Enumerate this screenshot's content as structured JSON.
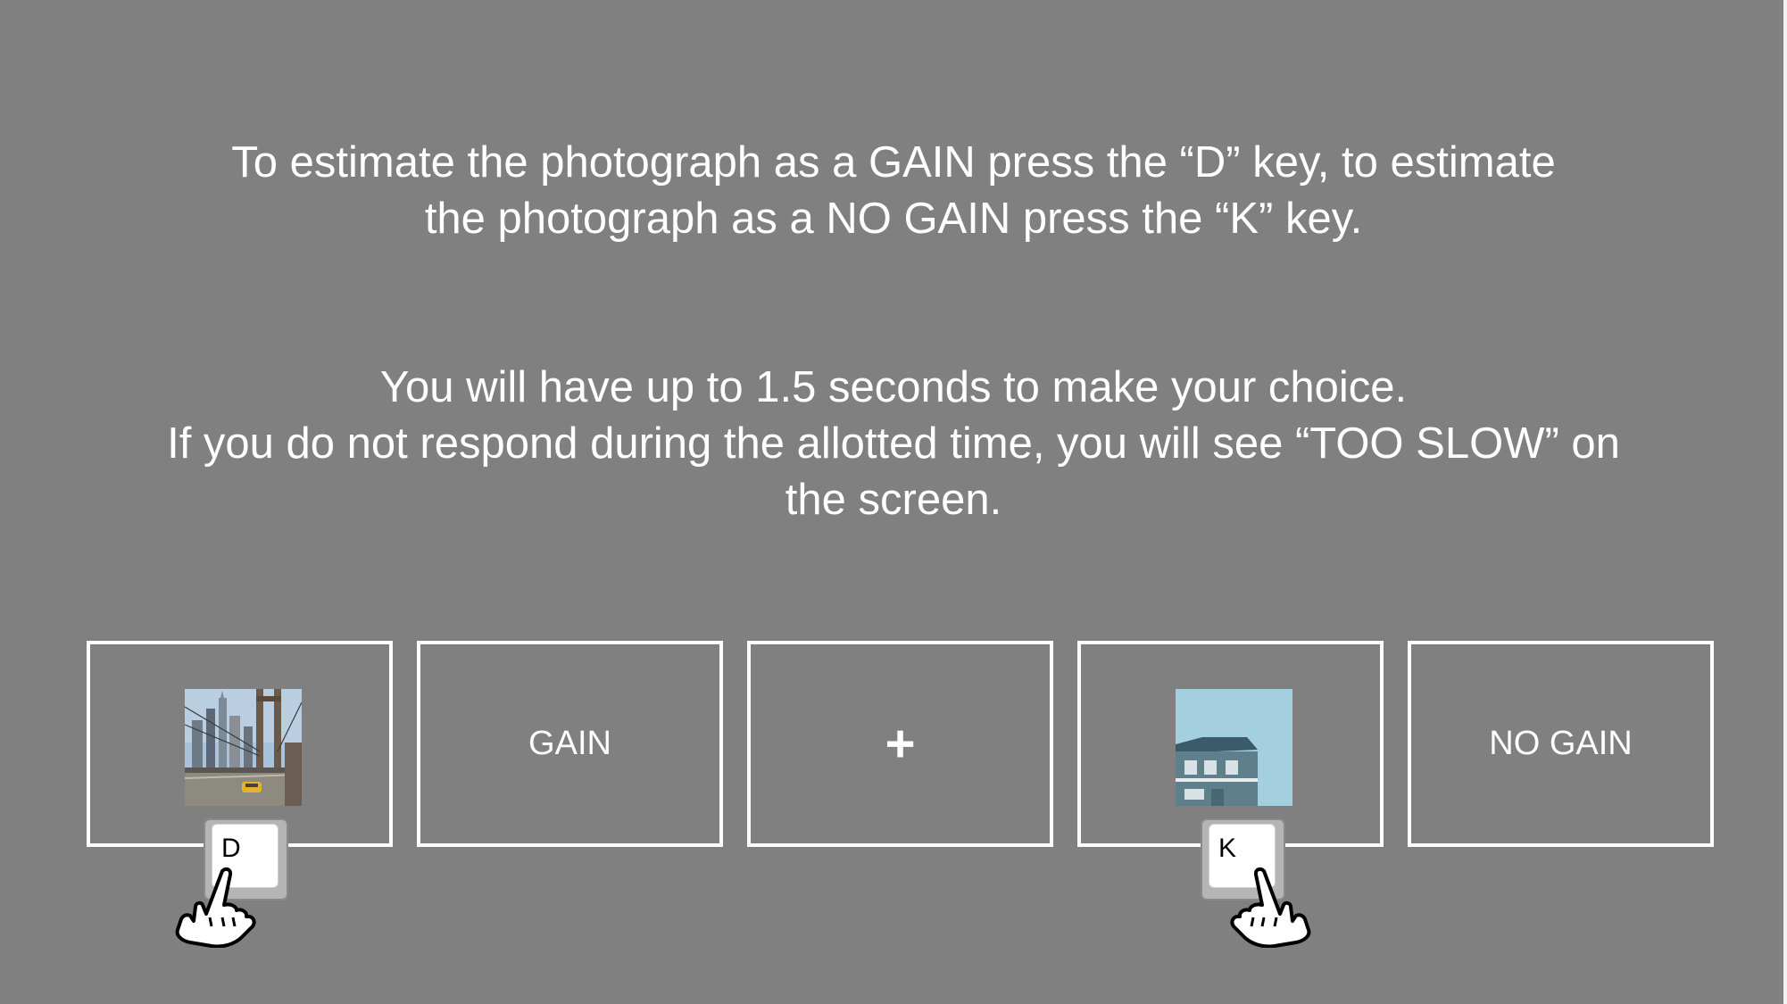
{
  "instructions": {
    "line1": "To estimate the photograph as a GAIN press the “D” key, to estimate",
    "line2": "the photograph as a NO GAIN press the “K” key.",
    "line3": "You will have up to 1.5 seconds to make your choice.",
    "line4": "If you do not respond during the allotted time, you will see “TOO SLOW” on",
    "line5": "the screen."
  },
  "panels": {
    "gain_label": "GAIN",
    "fixation": "+",
    "no_gain_label": "NO GAIN"
  },
  "keys": {
    "d": "D",
    "k": "K"
  },
  "icons": {
    "left_hand": "pointing-hand-icon",
    "right_hand": "pointing-hand-icon"
  },
  "colors": {
    "background": "#808080",
    "foreground": "#ffffff"
  }
}
